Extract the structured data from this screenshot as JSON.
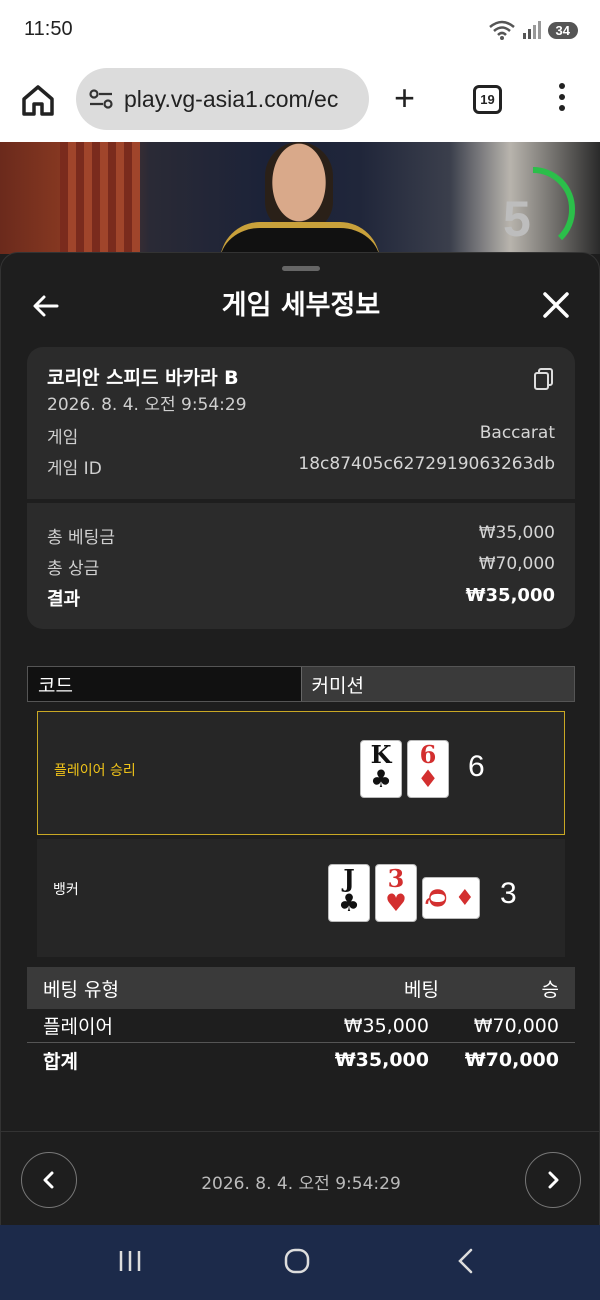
{
  "status_bar": {
    "time": "11:50",
    "battery": "34",
    "wifi_label": "6"
  },
  "browser": {
    "url": "play.vg-asia1.com/ec",
    "tab_count": "19",
    "new_tab_label": "+"
  },
  "video": {
    "countdown": "5"
  },
  "panel": {
    "title": "게임 세부정보",
    "game_name": "코리안 스피드 바카라 B",
    "game_time": "2026. 8. 4. 오전 9:54:29",
    "rows": [
      {
        "label": "게임",
        "value": "Baccarat"
      },
      {
        "label": "게임 ID",
        "value": "18c87405c6272919063263db"
      }
    ],
    "totals": [
      {
        "label": "총 베팅금",
        "value": "₩35,000"
      },
      {
        "label": "총 상금",
        "value": "₩70,000"
      },
      {
        "label": "결과",
        "value": "₩35,000"
      }
    ],
    "tabs": [
      "코드",
      "커미션"
    ]
  },
  "results": {
    "player": {
      "label": "플레이어 승리",
      "score": "6",
      "cards": [
        {
          "rank": "K",
          "suit": "♣"
        },
        {
          "rank": "6",
          "suit": "♦"
        }
      ]
    },
    "banker": {
      "label": "뱅커",
      "score": "3",
      "cards": [
        {
          "rank": "J",
          "suit": "♣"
        },
        {
          "rank": "3",
          "suit": "♥"
        },
        {
          "rank": "Q",
          "suit": "♦"
        }
      ]
    }
  },
  "bet_table": {
    "headers": [
      "베팅 유형",
      "베팅",
      "승"
    ],
    "rows": [
      {
        "type": "플레이어",
        "bet": "₩35,000",
        "win": "₩70,000"
      }
    ],
    "total": {
      "type": "합계",
      "bet": "₩35,000",
      "win": "₩70,000"
    }
  },
  "footer": {
    "time": "2026. 8. 4. 오전 9:54:29"
  },
  "colors": {
    "win_highlight": "#c9a824",
    "player_win_text": "#f0c419",
    "card_red": "#d32f2f"
  }
}
